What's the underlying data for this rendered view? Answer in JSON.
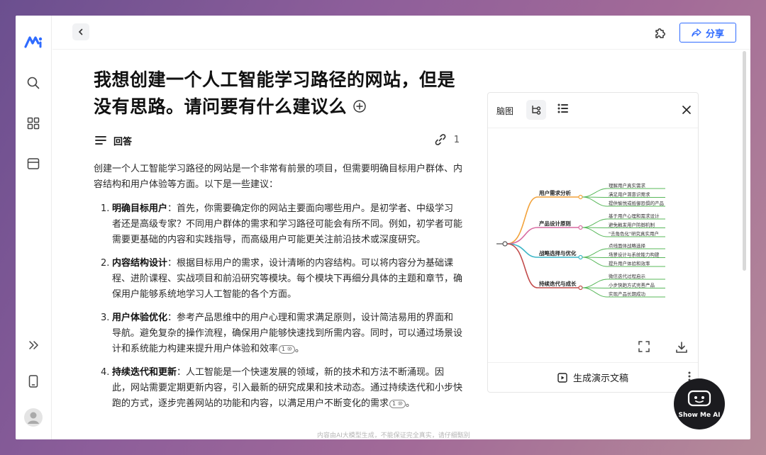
{
  "app": {
    "share_label": "分享"
  },
  "question": {
    "title": "我想创建一个人工智能学习路径的网站，但是没有思路。请问要有什么建议么"
  },
  "answer": {
    "header_label": "回答",
    "source_count": "1",
    "intro": "创建一个人工智能学习路径的网站是一个非常有前景的项目，但需要明确目标用户群体、内容结构和用户体验等方面。以下是一些建议：",
    "items": [
      {
        "num": "1.",
        "heading": "明确目标用户",
        "text": "：首先，你需要确定你的网站主要面向哪些用户。是初学者、中级学习者还是高级专家？不同用户群体的需求和学习路径可能会有所不同。例如，初学者可能需要更基础的内容和实践指导，而高级用户可能更关注前沿技术或深度研究。",
        "ref": ""
      },
      {
        "num": "2.",
        "heading": "内容结构设计",
        "text": "：根据目标用户的需求，设计清晰的内容结构。可以将内容分为基础课程、进阶课程、实战项目和前沿研究等模块。每个模块下再细分具体的主题和章节，确保用户能够系统地学习人工智能的各个方面。",
        "ref": ""
      },
      {
        "num": "3.",
        "heading": "用户体验优化",
        "text": "：参考产品思维中的用户心理和需求满足原则，设计简洁易用的界面和导航。避免复杂的操作流程，确保用户能够快速找到所需内容。同时，可以通过场景设计和系统能力构建来提升用户体验和效率",
        "ref": "1 ⑩"
      },
      {
        "num": "4.",
        "heading": "持续迭代和更新",
        "text": "：人工智能是一个快速发展的领域，新的技术和方法不断涌现。因此，网站需要定期更新内容，引入最新的研究成果和技术动态。通过持续迭代和小步快跑的方式，逐步完善网站的功能和内容，以满足用户不断变化的需求",
        "ref": "1 ⑩"
      }
    ],
    "footer_note": "内容由AI大模型生成，不能保证完全真实，请仔细甄别"
  },
  "panel": {
    "tab_label": "脑图",
    "generate_label": "生成演示文稿",
    "mindmap": {
      "branches": [
        {
          "label": "用户需求分析",
          "color": "#f2a23a",
          "leaves": [
            "理解用户真实需求",
            "满足用户潜意识需求",
            "提供愉悦或抵御恐惧的产品"
          ]
        },
        {
          "label": "产品设计原则",
          "color": "#d86aa0",
          "leaves": [
            "基于用户心理和需求设计",
            "避免触发用户防御机制",
            "\"去角色化\"研究真实用户"
          ]
        },
        {
          "label": "战略选择与优化",
          "color": "#3bb6c6",
          "leaves": [
            "点线面体战略选择",
            "场景设计与系统能力构建",
            "提升用户体验和效率"
          ]
        },
        {
          "label": "持续迭代与成长",
          "color": "#c24b4b",
          "leaves": [
            "微信迭代过程启示",
            "小步快跑方式完善产品",
            "实现产品长期成功"
          ]
        }
      ],
      "leaf_color": "#58b85a"
    }
  },
  "badge": {
    "label": "Show Me AI"
  }
}
